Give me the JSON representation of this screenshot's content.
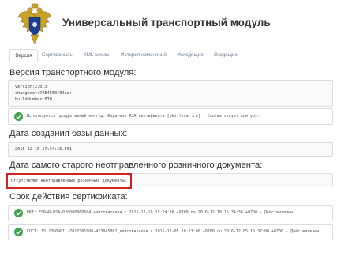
{
  "header": {
    "title": "Универсальный транспортный модуль",
    "emblem_icon": "emblem-icon"
  },
  "tabs": [
    {
      "label": "Версия",
      "active": true
    },
    {
      "label": "Сертификаты",
      "active": false
    },
    {
      "label": "XML схемы",
      "active": false
    },
    {
      "label": "История изменений",
      "active": false
    },
    {
      "label": "Исходящие",
      "active": false
    },
    {
      "label": "Входящие",
      "active": false
    }
  ],
  "version_section": {
    "title": "Версия транспортного модуля:",
    "lines": [
      "version:2.0.3",
      "changeset:7084560f34aa+",
      "buildNumber:870"
    ],
    "status": "Используется продуктивный контур. Издатель RSA сертификата [pki.fsrar.ru] - Соответствует контуру."
  },
  "db_section": {
    "title": "Дата создания базы данных:",
    "value": "2015-12-15 17:34:15.561"
  },
  "oldest_doc_section": {
    "title": "Дата самого старого неотправленного розничного документа:",
    "value": "Отсутствуют неотправленные розничные документы."
  },
  "cert_section": {
    "title": "Срок действия сертификата:",
    "rows": [
      "PKI: FSRAR-RSA-020000069604 действителен с 2015-12-10 15:24:36 +0700 по 2016-12-10 15:34:36 +0700 - Действителен",
      "ГОСТ: 15120509011-7017361800-423045002 действителен с 2015-12-05 10:27:00 +0700 по 2016-12-05 10:37:00 +0700 - Действителен"
    ]
  },
  "colors": {
    "check_green": "#3fa34d",
    "highlight_red": "#d42020",
    "tab_link": "#6a7b8c"
  }
}
